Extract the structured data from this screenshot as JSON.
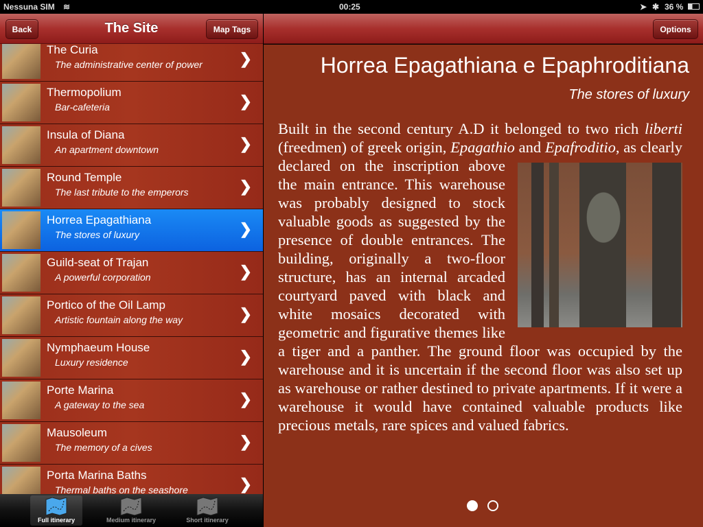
{
  "status": {
    "carrier": "Nessuna SIM",
    "time": "00:25",
    "battery": "36 %"
  },
  "left_nav": {
    "back": "Back",
    "title": "The Site",
    "map_tags": "Map Tags"
  },
  "right_nav": {
    "options": "Options"
  },
  "list": [
    {
      "title": "The Curia",
      "subtitle": "The administrative center of power"
    },
    {
      "title": "Thermopolium",
      "subtitle": "Bar-cafeteria"
    },
    {
      "title": "Insula of Diana",
      "subtitle": "An apartment downtown"
    },
    {
      "title": "Round Temple",
      "subtitle": "The last tribute to the emperors"
    },
    {
      "title": "Horrea Epagathiana",
      "subtitle": "The stores of luxury",
      "selected": true
    },
    {
      "title": "Guild-seat of Trajan",
      "subtitle": "A powerful corporation"
    },
    {
      "title": "Portico of the Oil Lamp",
      "subtitle": "Artistic fountain along the way"
    },
    {
      "title": "Nymphaeum House",
      "subtitle": "Luxury residence"
    },
    {
      "title": "Porte Marina",
      "subtitle": "A gateway to the sea"
    },
    {
      "title": "Mausoleum",
      "subtitle": "The memory of a cives"
    },
    {
      "title": "Porta Marina Baths",
      "subtitle": "Thermal baths on the seashore"
    }
  ],
  "tabs": [
    {
      "label": "Full itinerary",
      "active": true
    },
    {
      "label": "Medium itinerary"
    },
    {
      "label": "Short itinerary"
    }
  ],
  "article": {
    "title": "Horrea Epagathiana e Epaphroditiana",
    "subtitle": "The stores of luxury",
    "segments": [
      {
        "t": "Built in the second century A.D it belonged to two rich "
      },
      {
        "t": "liberti",
        "i": true
      },
      {
        "t": " (freedmen) of greek origin, "
      },
      {
        "t": "Epagathio",
        "i": true
      },
      {
        "t": " and "
      },
      {
        "t": "Epafroditio",
        "i": true
      },
      {
        "t": ", as clearly declared on the inscription "
      },
      {
        "pic": true
      },
      {
        "t": "above the main entrance.  This warehouse was probably designed to stock valuable goods as suggested by the presence of double entrances. The building, originally a two-floor structure, has an internal arcaded courtyard paved with black and white mosaics decorated with geometric and figurative themes like a tiger and a panther. The ground floor was occupied by the warehouse and it is uncertain if the second floor was also set up as warehouse or rather destined to private apartments. If it were a warehouse it would have contained valuable products like precious metals, rare spices and valued fabrics."
      }
    ]
  },
  "pager": {
    "pages": 2,
    "current": 1
  }
}
